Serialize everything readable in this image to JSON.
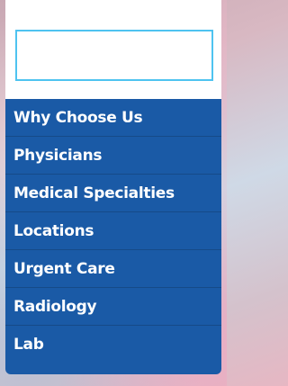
{
  "search": {
    "value": "",
    "placeholder": ""
  },
  "menu": {
    "items": [
      {
        "label": "Why Choose Us"
      },
      {
        "label": "Physicians"
      },
      {
        "label": "Medical Specialties"
      },
      {
        "label": "Locations"
      },
      {
        "label": "Urgent Care"
      },
      {
        "label": "Radiology"
      },
      {
        "label": "Lab"
      }
    ]
  },
  "colors": {
    "menu_background": "#1a5aa6",
    "search_border": "#4ec3f0",
    "menu_text": "#ffffff"
  }
}
